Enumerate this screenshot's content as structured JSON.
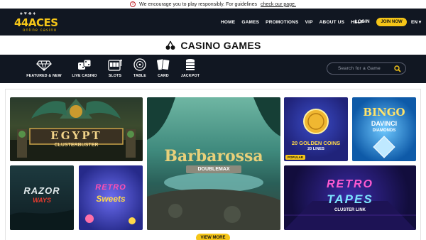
{
  "notice": {
    "text": "We encourage you to play responsibly. For guidelines",
    "link": "check our page."
  },
  "header": {
    "brand": "44ACES",
    "tagline": "online casino",
    "nav": [
      "HOME",
      "GAMES",
      "PROMOTIONS",
      "VIP",
      "ABOUT US",
      "HELP"
    ],
    "login": "LOGIN",
    "join": "JOIN NOW",
    "language": "EN"
  },
  "page": {
    "title": "CASINO GAMES"
  },
  "categories": [
    {
      "label": "FEATURED & NEW",
      "icon": "diamond-icon"
    },
    {
      "label": "LIVE CASINO",
      "icon": "dice-icon"
    },
    {
      "label": "SLOTS",
      "icon": "slot-machine-icon"
    },
    {
      "label": "TABLE",
      "icon": "roulette-icon"
    },
    {
      "label": "CARD",
      "icon": "cards-icon"
    },
    {
      "label": "JACKPOT",
      "icon": "coin-stack-icon"
    }
  ],
  "search": {
    "placeholder": "Search for a Game"
  },
  "games": {
    "egypt": {
      "line1": "EGYPT",
      "line2": "CLUSTERBUSTER"
    },
    "barbarossa": {
      "line1": "Barbarossa",
      "line2": "DOUBLEMAX"
    },
    "golden_coins": {
      "line1": "20 GOLDEN COINS",
      "line2": "20 LINES",
      "badge": "POPULAR"
    },
    "bingo": {
      "line1": "BINGO",
      "line2": "DAVINCI",
      "line3": "DIAMONDS"
    },
    "razor": {
      "line1": "RAZOR",
      "line2": "WAYS"
    },
    "sweets": {
      "line1": "RETRO",
      "line2": "Sweets"
    },
    "tapes": {
      "line1": "RETRO",
      "line2": "TAPES",
      "line3": "CLUSTER LINK"
    }
  },
  "view_more": "VIEW MORE",
  "colors": {
    "header_bg": "#111722",
    "accent": "#f5c518",
    "warning": "#c0232a"
  }
}
